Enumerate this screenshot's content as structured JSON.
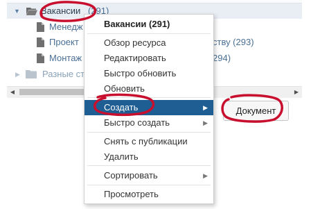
{
  "tree": {
    "root_folder": {
      "label": "Вакансии",
      "count": "(291)"
    },
    "children": [
      {
        "label": "Менедж"
      },
      {
        "label": "Проект",
        "suffix": "ству (293)"
      },
      {
        "label": "Монтаж",
        "suffix": "294)"
      }
    ],
    "collapsed_folder": {
      "label": "Разные ст"
    }
  },
  "context_menu": {
    "title": "Вакансии (291)",
    "items": [
      {
        "label": "Обзор ресурса"
      },
      {
        "label": "Редактировать"
      },
      {
        "label": "Быстро обновить"
      },
      {
        "label": "Обновить"
      },
      {
        "label": "Создать",
        "submenu": true,
        "active": true
      },
      {
        "label": "Быстро создать",
        "submenu": true
      },
      {
        "label": "Снять с публикации"
      },
      {
        "label": "Удалить"
      },
      {
        "label": "Сортировать",
        "submenu": true
      },
      {
        "label": "Просмотреть"
      }
    ]
  },
  "document_button": {
    "label": "Документ"
  },
  "icons": {
    "folder": "folder-icon",
    "document": "document-icon",
    "expand": "triangle-down-icon",
    "collapse": "triangle-right-icon",
    "submenu": "chevron-right-icon"
  },
  "colors": {
    "tree_link": "#4a6f94",
    "menu_highlight": "#1f5e93",
    "selection_bg": "#e8eef4",
    "annotation": "#c8102e"
  }
}
